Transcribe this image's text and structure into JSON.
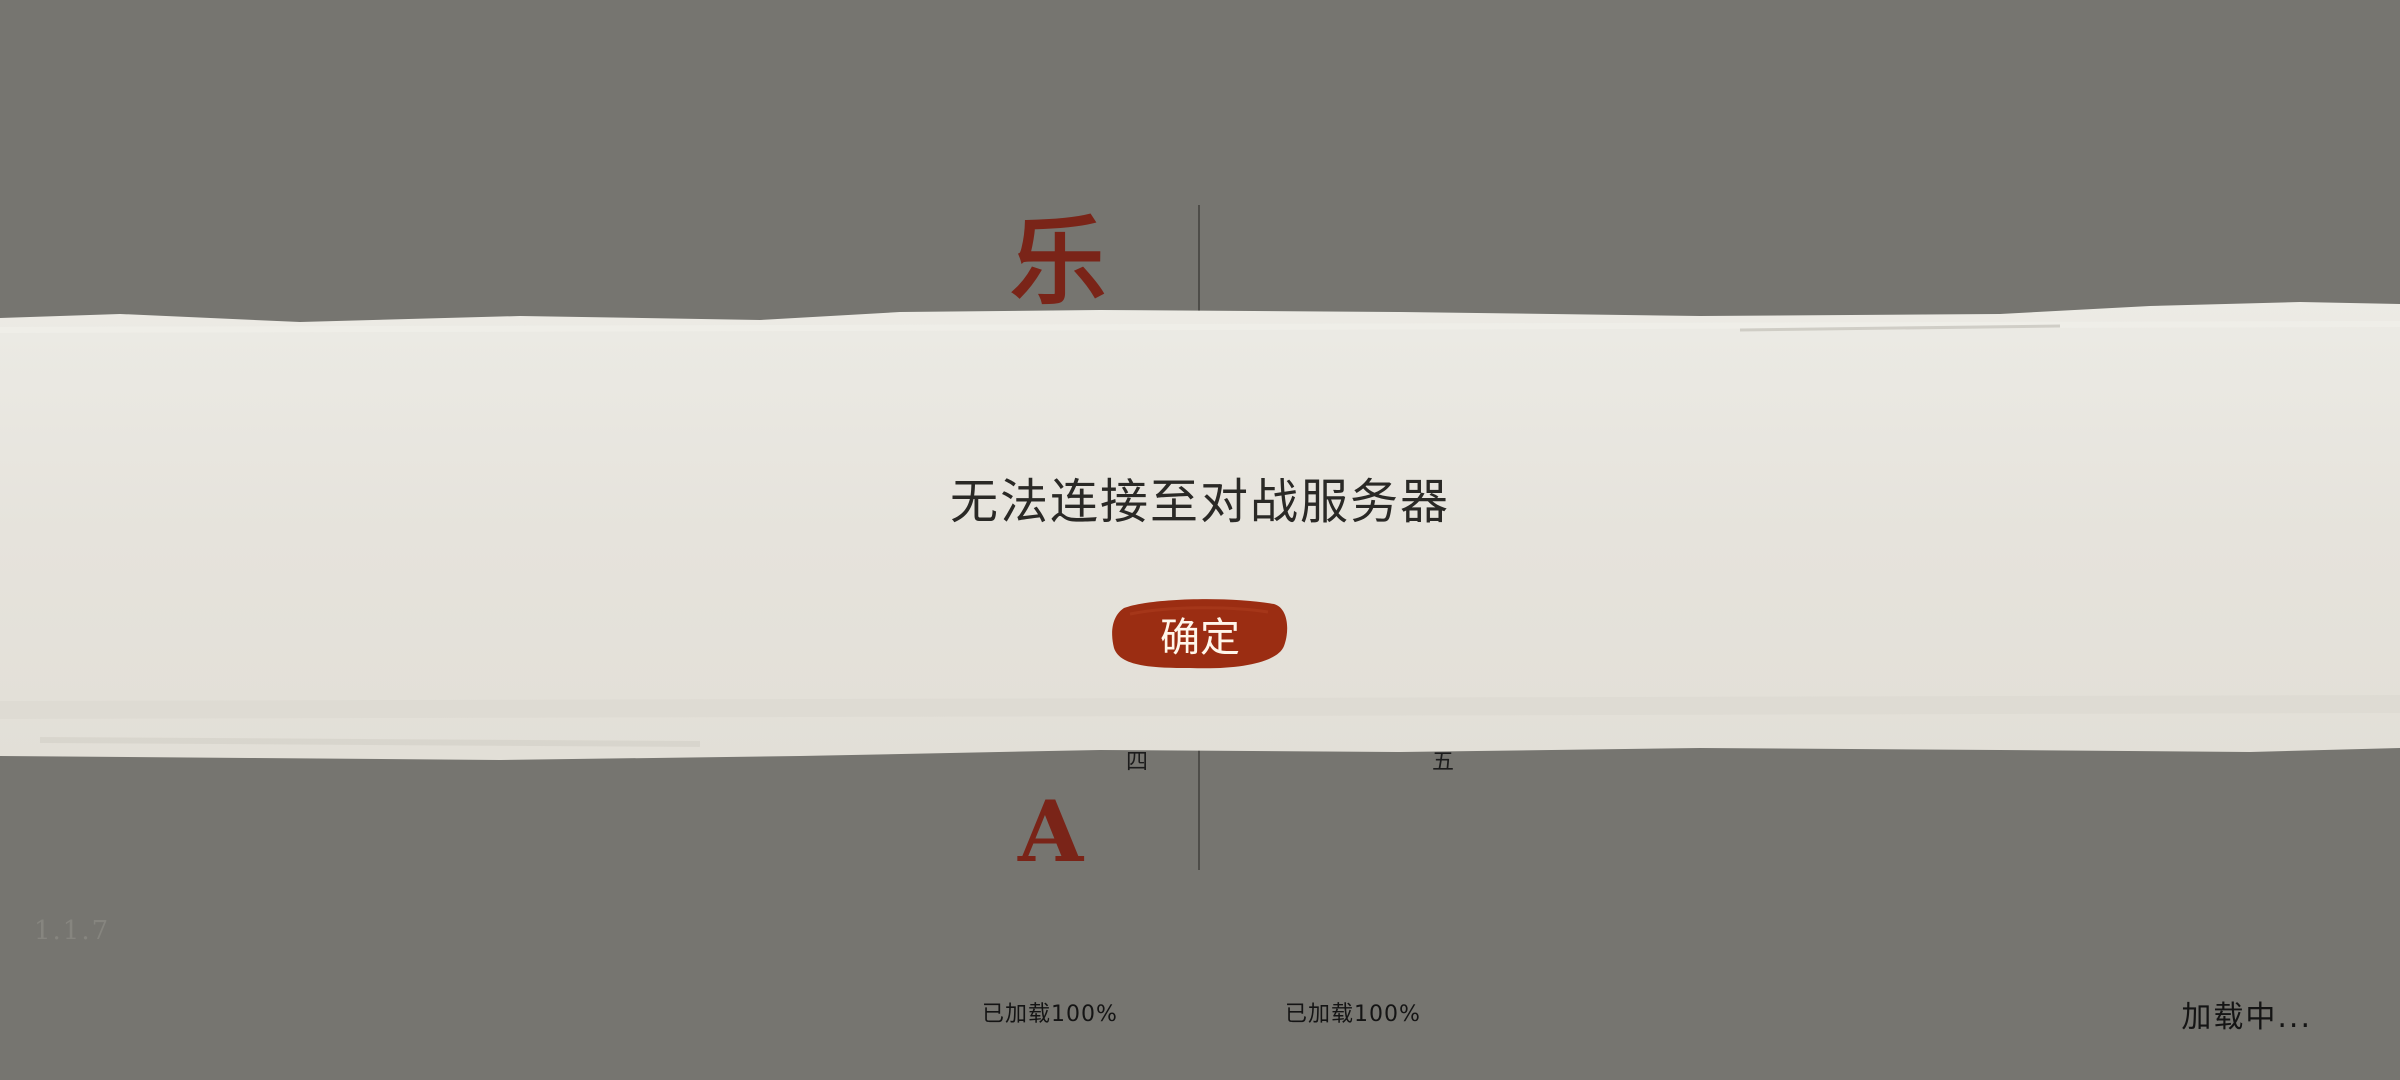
{
  "background": {
    "color": "#767570",
    "banner_color": "#e7e4dd",
    "accent_red": "#9b2d12"
  },
  "lobby": {
    "vertical_chars": [
      "乐",
      "A"
    ],
    "slot_labels": [
      "四",
      "五"
    ],
    "version": "1.1.7",
    "player_load_statuses": [
      "已加载100%",
      "已加载100%"
    ],
    "loading_status": "加载中..."
  },
  "dialog": {
    "message": "无法连接至对战服务器",
    "confirm_label": "确定"
  }
}
